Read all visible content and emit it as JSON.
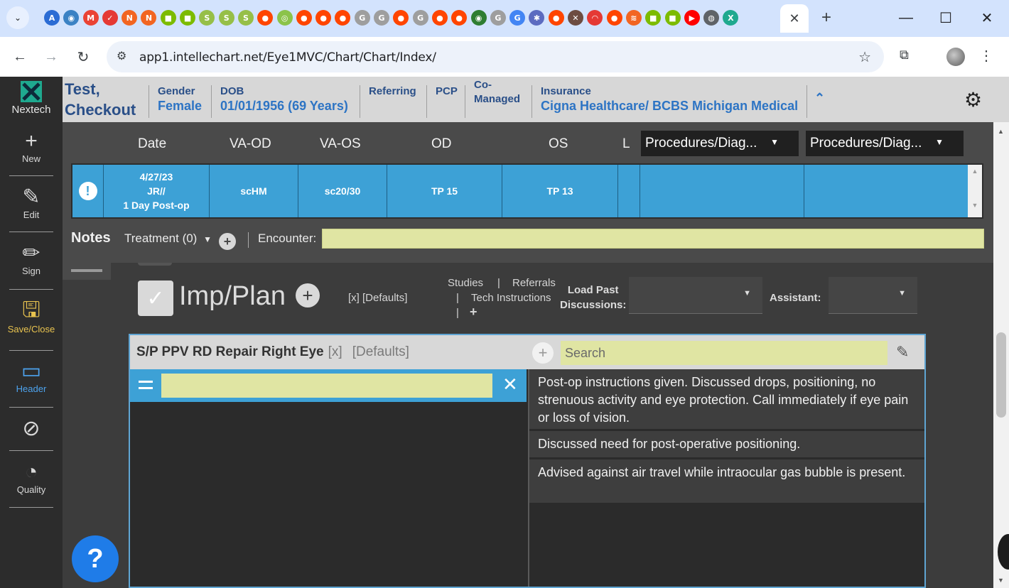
{
  "browser": {
    "url": "app1.intellechart.net/Eye1MVC/Chart/Chart/Index/",
    "favicons": [
      {
        "color": "#2b6cd4",
        "glyph": "A"
      },
      {
        "color": "#3b82c4",
        "glyph": "◉"
      },
      {
        "color": "#ea4335",
        "glyph": "M"
      },
      {
        "color": "#e53935",
        "glyph": "✓"
      },
      {
        "color": "#f26522",
        "glyph": "N"
      },
      {
        "color": "#f26522",
        "glyph": "N"
      },
      {
        "color": "#7cbb00",
        "glyph": "■"
      },
      {
        "color": "#7cbb00",
        "glyph": "■"
      },
      {
        "color": "#96bf48",
        "glyph": "S"
      },
      {
        "color": "#96bf48",
        "glyph": "S"
      },
      {
        "color": "#96bf48",
        "glyph": "S"
      },
      {
        "color": "#ff4500",
        "glyph": "●"
      },
      {
        "color": "#8bc34a",
        "glyph": "◎"
      },
      {
        "color": "#ff4500",
        "glyph": "●"
      },
      {
        "color": "#ff4500",
        "glyph": "●"
      },
      {
        "color": "#ff4500",
        "glyph": "●"
      },
      {
        "color": "#9e9e9e",
        "glyph": "G"
      },
      {
        "color": "#9e9e9e",
        "glyph": "G"
      },
      {
        "color": "#ff4500",
        "glyph": "●"
      },
      {
        "color": "#9e9e9e",
        "glyph": "G"
      },
      {
        "color": "#ff4500",
        "glyph": "●"
      },
      {
        "color": "#ff4500",
        "glyph": "●"
      },
      {
        "color": "#2e7d32",
        "glyph": "◉"
      },
      {
        "color": "#9e9e9e",
        "glyph": "G"
      },
      {
        "color": "#4285f4",
        "glyph": "G"
      },
      {
        "color": "#5c6bc0",
        "glyph": "✱"
      },
      {
        "color": "#ff4500",
        "glyph": "●"
      },
      {
        "color": "#6d4c41",
        "glyph": "✕"
      },
      {
        "color": "#e53935",
        "glyph": "◠"
      },
      {
        "color": "#ff4500",
        "glyph": "●"
      },
      {
        "color": "#f26522",
        "glyph": "≋"
      },
      {
        "color": "#7cbb00",
        "glyph": "■"
      },
      {
        "color": "#7cbb00",
        "glyph": "■"
      },
      {
        "color": "#ff0000",
        "glyph": "▶"
      },
      {
        "color": "#5f6368",
        "glyph": "◍"
      },
      {
        "color": "#1fa98f",
        "glyph": "X"
      }
    ]
  },
  "sidebar": {
    "logo_text": "Nextech",
    "items": [
      {
        "label": "New",
        "icon": "+"
      },
      {
        "label": "Edit",
        "icon": "✎"
      },
      {
        "label": "Sign",
        "icon": "✏"
      },
      {
        "label": "Save/Close",
        "icon": "🖫"
      },
      {
        "label": "Header",
        "icon": "▭"
      },
      {
        "label": "",
        "icon": "⊘"
      },
      {
        "label": "Quality",
        "icon": "◔"
      }
    ]
  },
  "patient": {
    "name_line1": "Test,",
    "name_line2": "Checkout",
    "gender_label": "Gender",
    "gender": "Female",
    "dob_label": "DOB",
    "dob": "01/01/1956 (69 Years)",
    "referring_label": "Referring",
    "pcp_label": "PCP",
    "comanaged_label_1": "Co-",
    "comanaged_label_2": "Managed",
    "insurance_label": "Insurance",
    "insurance": "Cigna Healthcare/ BCBS Michigan Medical"
  },
  "exam": {
    "headers": {
      "date": "Date",
      "va_od": "VA-OD",
      "va_os": "VA-OS",
      "od": "OD",
      "os": "OS",
      "l": "L"
    },
    "dropdown1": "Procedures/Diag...",
    "dropdown2": "Procedures/Diag...",
    "row": {
      "date_line1": "4/27/23",
      "date_line2": "JR//",
      "date_line3": "1 Day Post-op",
      "va_od": "scHM",
      "va_os": "sc20/30",
      "od": "TP 15",
      "os": "TP 13"
    }
  },
  "notes": {
    "title": "Notes",
    "treatment": "Treatment (0)",
    "encounter_label": "Encounter:",
    "encounter_value": ""
  },
  "impplan": {
    "title": "Imp/Plan",
    "defaults_link": "[x]  [Defaults]",
    "studies": "Studies",
    "referrals": "Referrals",
    "tech_instructions": "Tech Instructions",
    "load_past_1": "Load Past",
    "load_past_2": "Discussions:",
    "assistant": "Assistant:"
  },
  "panel": {
    "title": "S/P PPV RD Repair Right Eye",
    "x_link": "[x]",
    "defaults_link": "[Defaults]",
    "search_placeholder": "Search",
    "instructions": [
      "Post-op instructions given. Discussed drops, positioning, no strenuous activity and eye protection. Call immediately if eye pain or loss of vision.",
      "Discussed need for post-operative positioning.",
      "Advised against air travel while intraocular gas bubble is present."
    ]
  },
  "help": {
    "label": "?"
  }
}
